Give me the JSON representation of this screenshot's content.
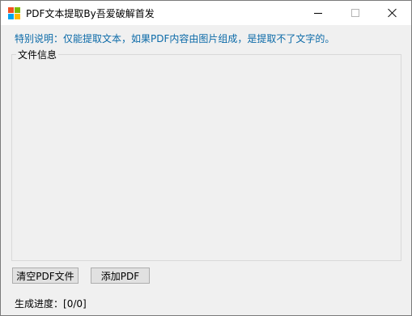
{
  "window": {
    "title": "PDF文本提取By吾爱破解首发",
    "icon": "windows-logo-icon",
    "controls": [
      "minimize",
      "maximize",
      "close"
    ]
  },
  "notice": {
    "text": "特别说明：仅能提取文本，如果PDF内容由图片组成，是提取不了文字的。",
    "color": "#0b6aa8"
  },
  "file_info": {
    "label": "文件信息"
  },
  "buttons": {
    "clear": "清空PDF文件",
    "add": "添加PDF"
  },
  "status": {
    "progress_label": "生成进度：",
    "progress_value": "[0/0]"
  }
}
